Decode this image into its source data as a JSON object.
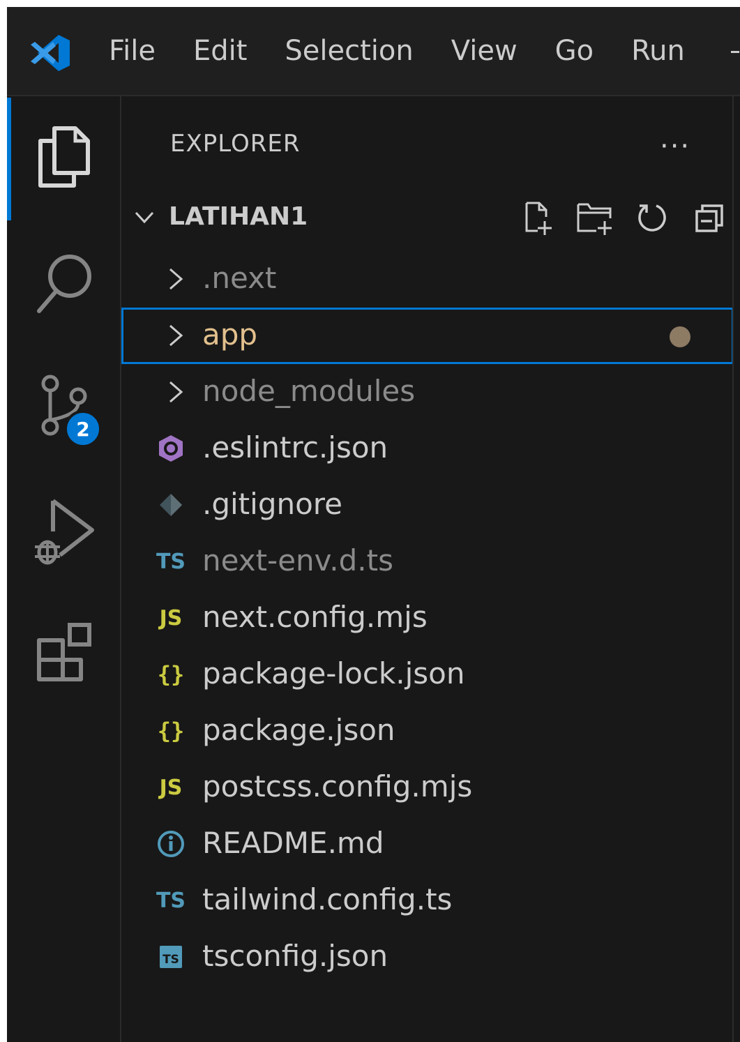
{
  "menu": {
    "items": [
      "File",
      "Edit",
      "Selection",
      "View",
      "Go",
      "Run"
    ]
  },
  "activity_bar": {
    "icons": [
      "explorer-icon",
      "search-icon",
      "source-control-icon",
      "run-debug-icon",
      "extensions-icon"
    ],
    "source_control_badge": "2"
  },
  "explorer": {
    "title": "EXPLORER",
    "more": "···",
    "section": {
      "title": "LATIHAN1",
      "actions": [
        "new-file-icon",
        "new-folder-icon",
        "refresh-icon",
        "collapse-all-icon"
      ]
    },
    "folders": [
      {
        "label": ".next",
        "dimmed": true
      },
      {
        "label": "app",
        "selected": true,
        "modified": true,
        "color": "#e2c08d"
      },
      {
        "label": "node_modules",
        "dimmed": true
      }
    ],
    "files": [
      {
        "label": ".eslintrc.json",
        "icon": "eslint-icon",
        "color": "#a074c4"
      },
      {
        "label": ".gitignore",
        "icon": "git-icon",
        "color": "#41535b"
      },
      {
        "label": "next-env.d.ts",
        "icon": "ts",
        "icon_text": "TS",
        "dimmed": true
      },
      {
        "label": "next.config.mjs",
        "icon": "js",
        "icon_text": "JS"
      },
      {
        "label": "package-lock.json",
        "icon": "json",
        "icon_text": "{}"
      },
      {
        "label": "package.json",
        "icon": "json",
        "icon_text": "{}"
      },
      {
        "label": "postcss.config.mjs",
        "icon": "js",
        "icon_text": "JS"
      },
      {
        "label": "README.md",
        "icon": "info-icon",
        "color": "#519aba"
      },
      {
        "label": "tailwind.config.ts",
        "icon": "ts",
        "icon_text": "TS"
      },
      {
        "label": "tsconfig.json",
        "icon": "tsconfig",
        "icon_text": "TS"
      }
    ]
  }
}
